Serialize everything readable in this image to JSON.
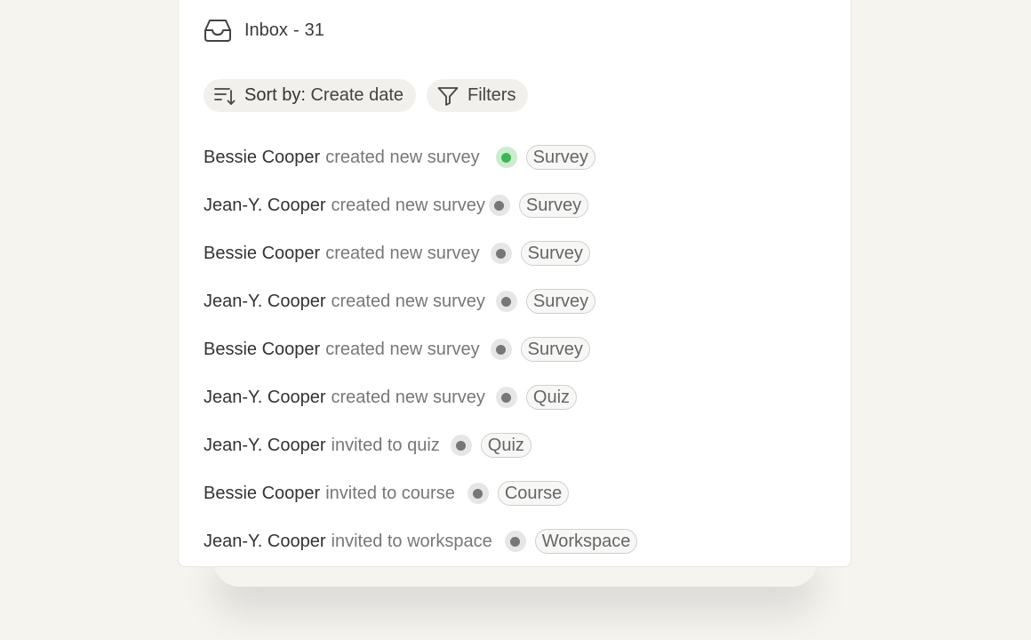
{
  "inbox": {
    "title": "Inbox",
    "separator": "-",
    "count": "31",
    "icon": "inbox-icon"
  },
  "toolbar": {
    "sort_label": "Sort by:",
    "sort_value": "Create date",
    "filters_label": "Filters"
  },
  "colors": {
    "active_dot": "#3cb651",
    "inactive_dot": "#777777"
  },
  "items": [
    {
      "name": "Bessie Cooper",
      "action": "created new survey",
      "tag": "Survey",
      "status": "active"
    },
    {
      "name": "Jean-Y. Cooper",
      "action": "created new survey",
      "tag": "Survey",
      "status": "read"
    },
    {
      "name": "Bessie Cooper",
      "action": "created new survey",
      "tag": "Survey",
      "status": "read"
    },
    {
      "name": "Jean-Y. Cooper",
      "action": "created new survey",
      "tag": "Survey",
      "status": "read"
    },
    {
      "name": "Bessie Cooper",
      "action": "created new survey",
      "tag": "Survey",
      "status": "read"
    },
    {
      "name": "Jean-Y. Cooper",
      "action": "created new survey",
      "tag": "Quiz",
      "status": "read"
    },
    {
      "name": "Jean-Y. Cooper",
      "action": "invited to quiz",
      "tag": "Quiz",
      "status": "read"
    },
    {
      "name": "Bessie Cooper",
      "action": "invited to course",
      "tag": "Course",
      "status": "read"
    },
    {
      "name": "Jean-Y. Cooper",
      "action": "invited to workspace",
      "tag": "Workspace",
      "status": "read"
    }
  ]
}
